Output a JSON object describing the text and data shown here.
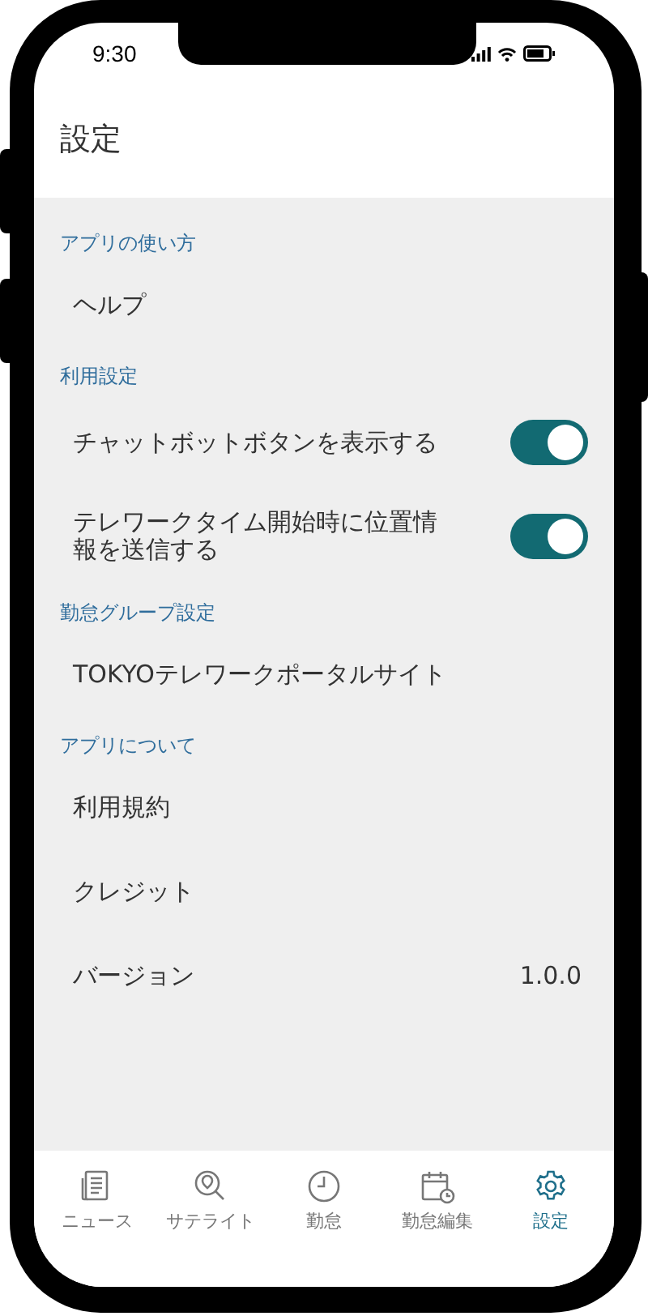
{
  "status_bar": {
    "time": "9:30"
  },
  "header": {
    "title": "設定"
  },
  "sections": [
    {
      "title": "アプリの使い方",
      "items": [
        {
          "kind": "link",
          "label": "ヘルプ"
        }
      ]
    },
    {
      "title": "利用設定",
      "items": [
        {
          "kind": "toggle",
          "label": "チャットボットボタンを表示する",
          "on": true
        },
        {
          "kind": "toggle",
          "label": "テレワークタイム開始時に位置情報を送信する",
          "on": true
        }
      ]
    },
    {
      "title": "勤怠グループ設定",
      "items": [
        {
          "kind": "link",
          "label": "TOKYOテレワークポータルサイト"
        }
      ]
    },
    {
      "title": "アプリについて",
      "items": [
        {
          "kind": "link",
          "label": "利用規約"
        },
        {
          "kind": "link",
          "label": "クレジット"
        },
        {
          "kind": "value",
          "label": "バージョン",
          "value": "1.0.0"
        }
      ]
    }
  ],
  "tab_bar": [
    {
      "label": "ニュース",
      "selected": false
    },
    {
      "label": "サテライト",
      "selected": false
    },
    {
      "label": "勤怠",
      "selected": false
    },
    {
      "label": "勤怠編集",
      "selected": false
    },
    {
      "label": "設定",
      "selected": true
    }
  ]
}
